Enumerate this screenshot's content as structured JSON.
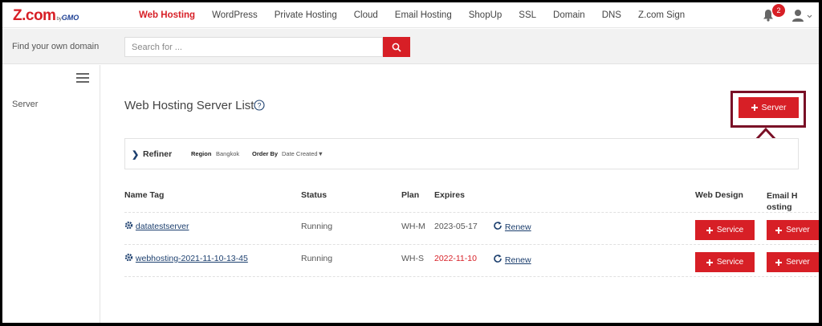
{
  "brand": {
    "logo": "Z.com",
    "by": "by",
    "gmo": "GMO",
    "accent": "#d71f26"
  },
  "nav": {
    "items": [
      "Web Hosting",
      "WordPress",
      "Private Hosting",
      "Cloud",
      "Email Hosting",
      "ShopUp",
      "SSL",
      "Domain",
      "DNS",
      "Z.com Sign"
    ],
    "active_index": 0,
    "notification_count": "2"
  },
  "search": {
    "label": "Find your own domain",
    "placeholder": "Search for ..."
  },
  "sidebar": {
    "items": [
      "Server"
    ]
  },
  "main": {
    "title": "Web Hosting Server List",
    "add_server_label": "Server",
    "refiner": {
      "label": "Refiner",
      "region_label": "Region",
      "region_value": "Bangkok",
      "orderby_label": "Order By",
      "orderby_value": "Date Created▼"
    },
    "columns": [
      "Name Tag",
      "Status",
      "Plan",
      "Expires",
      "Web Design",
      "Email H",
      "osting"
    ],
    "rows": [
      {
        "name": "datatestserver",
        "status": "Running",
        "plan": "WH-M",
        "expires": "2023-05-17",
        "renew": "Renew",
        "web_design": "Service",
        "email": "Server"
      },
      {
        "name": "webhosting-2021-11-10-13-45",
        "status": "Running",
        "plan": "WH-S",
        "expires": "2022-11-10",
        "renew": "Renew",
        "web_design": "Service",
        "email": "Server"
      }
    ]
  }
}
